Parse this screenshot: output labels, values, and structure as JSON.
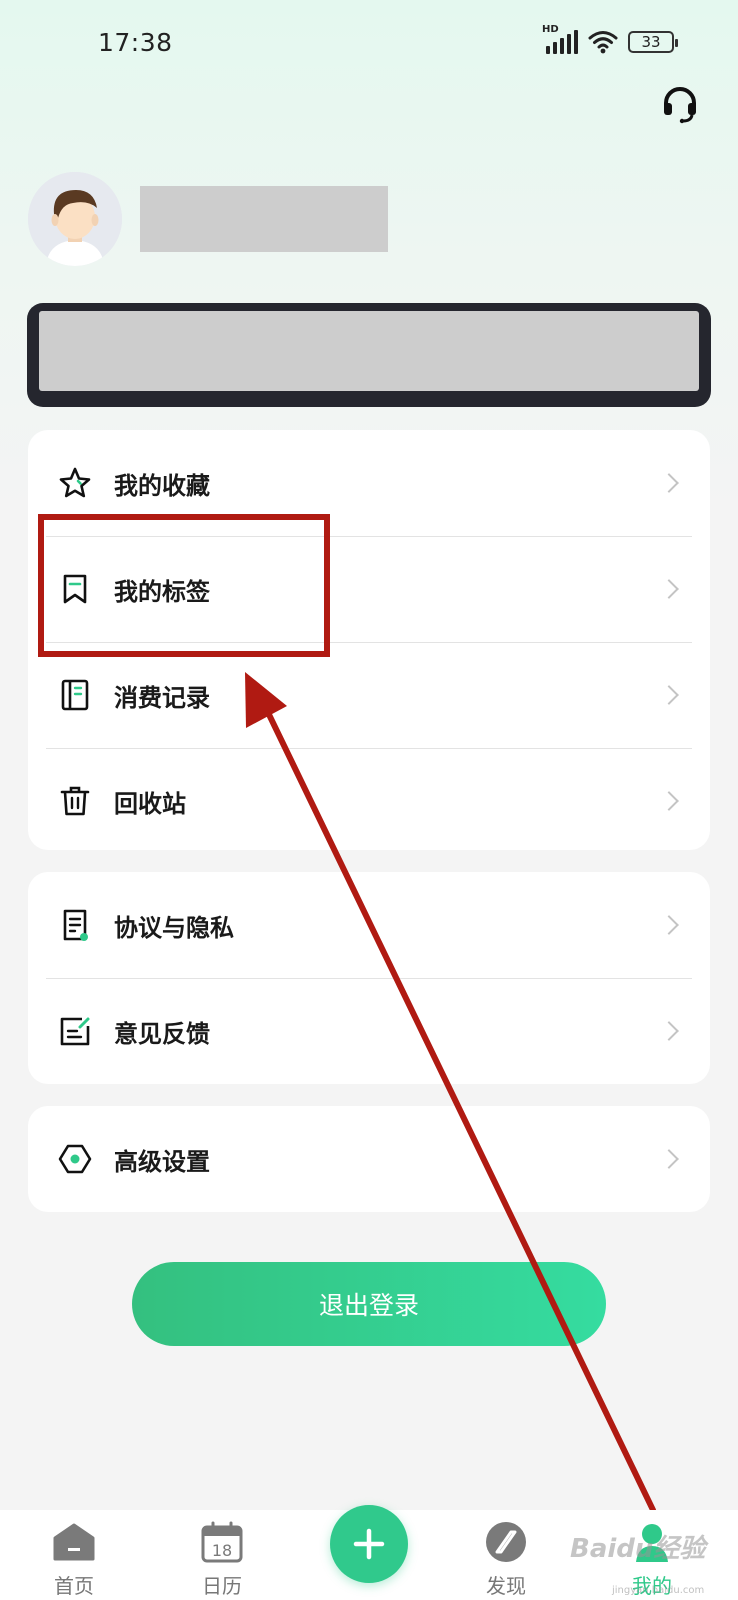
{
  "status_bar": {
    "time": "17:38",
    "network": "HD",
    "battery": "33"
  },
  "header": {
    "support_icon": "headset-icon"
  },
  "profile": {
    "avatar_icon": "avatar-icon"
  },
  "menu_group_1": [
    {
      "label": "我的收藏",
      "icon": "star-icon"
    },
    {
      "label": "我的标签",
      "icon": "bookmark-icon"
    },
    {
      "label": "消费记录",
      "icon": "ledger-icon"
    },
    {
      "label": "回收站",
      "icon": "trash-icon"
    }
  ],
  "menu_group_2": [
    {
      "label": "协议与隐私",
      "icon": "document-icon"
    },
    {
      "label": "意见反馈",
      "icon": "feedback-icon"
    }
  ],
  "menu_group_3": [
    {
      "label": "高级设置",
      "icon": "hexagon-settings-icon"
    }
  ],
  "logout_label": "退出登录",
  "tab_bar": {
    "tabs": [
      {
        "label": "首页",
        "icon": "home-icon"
      },
      {
        "label": "日历",
        "icon": "calendar-icon",
        "badge": "18"
      },
      {
        "label": "发现",
        "icon": "compass-icon"
      },
      {
        "label": "我的",
        "icon": "profile-icon",
        "active": true
      }
    ],
    "add_icon": "plus-icon"
  },
  "watermark": {
    "text": "Baidu经验",
    "sub": "jingyan.baidu.com"
  },
  "colors": {
    "accent": "#2fc98a",
    "annotation": "#b01a12"
  }
}
